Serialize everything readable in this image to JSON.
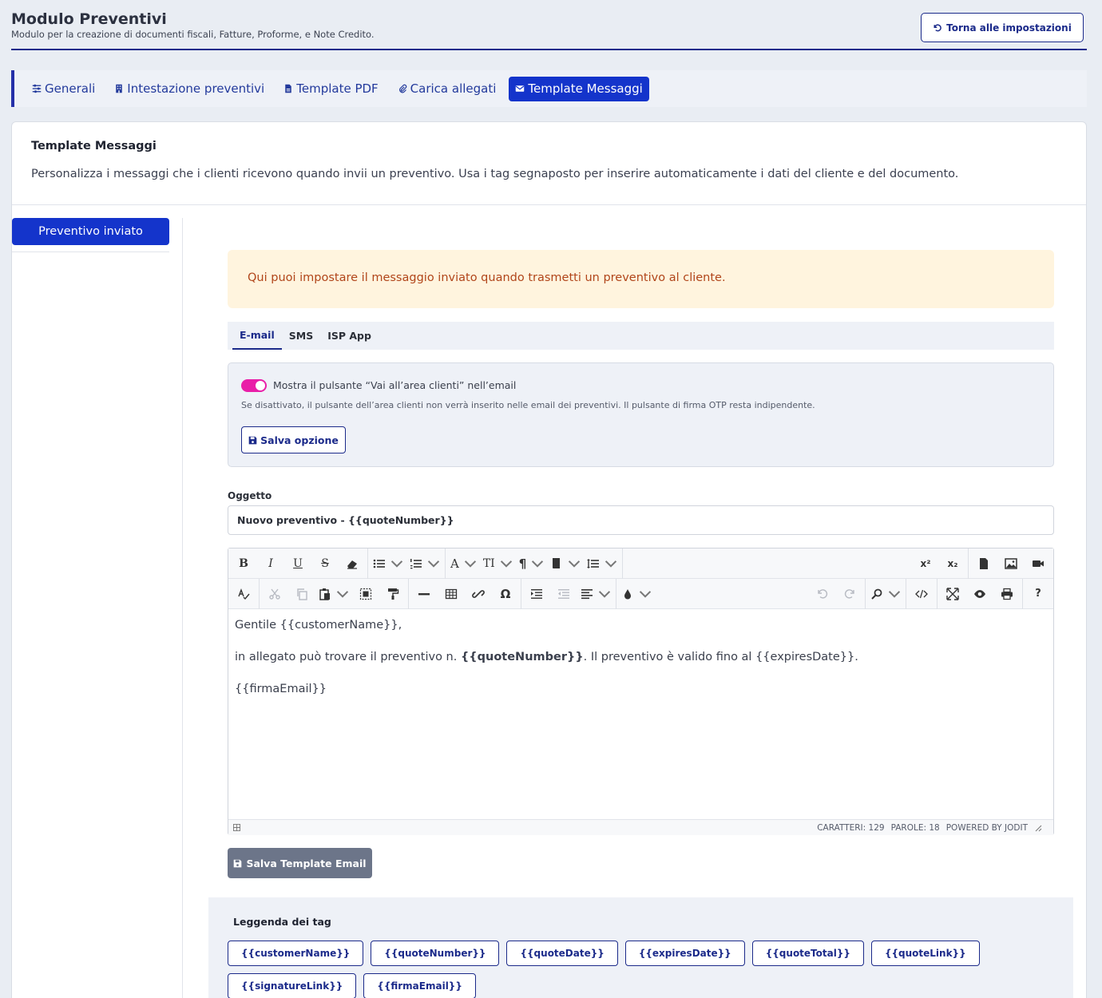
{
  "header": {
    "title": "Modulo Preventivi",
    "subtitle": "Modulo per la creazione di documenti fiscali, Fatture, Proforme, e Note Credito.",
    "back_button": "Torna alle impostazioni"
  },
  "nav_tabs": [
    {
      "label": "Generali",
      "icon": "sliders-icon"
    },
    {
      "label": "Intestazione preventivi",
      "icon": "building-icon"
    },
    {
      "label": "Template PDF",
      "icon": "pdf-file-icon"
    },
    {
      "label": "Carica allegati",
      "icon": "paperclip-icon"
    },
    {
      "label": "Template Messaggi",
      "icon": "envelope-icon",
      "active": true
    }
  ],
  "card": {
    "title": "Template Messaggi",
    "description": "Personalizza i messaggi che i clienti ricevono quando invii un preventivo. Usa i tag segnaposto per inserire automaticamente i dati del cliente e del documento."
  },
  "sidebar": {
    "items": [
      {
        "label": "Preventivo inviato",
        "active": true
      }
    ]
  },
  "alert": "Qui puoi impostare il messaggio inviato quando trasmetti un preventivo al cliente.",
  "channel_tabs": [
    {
      "label": "E-mail",
      "active": true
    },
    {
      "label": "SMS"
    },
    {
      "label": "ISP App"
    }
  ],
  "option": {
    "toggle_on": true,
    "label": "Mostra il pulsante “Vai all’area clienti” nell’email",
    "help": "Se disattivato, il pulsante dell’area clienti non verrà inserito nelle email dei preventivi. Il pulsante di firma OTP resta indipendente.",
    "save_label": "Salva opzione"
  },
  "subject": {
    "label": "Oggetto",
    "value": "Nuovo preventivo - {{quoteNumber}}"
  },
  "editor": {
    "line1": "Gentile {{customerName}},",
    "line2_before": "in allegato può trovare il preventivo n. ",
    "line2_bold": "{{quoteNumber}}",
    "line2_after": ". Il preventivo è valido fino al {{expiresDate}}.",
    "line3": "{{firmaEmail}}",
    "status_chars": "CARATTERI: 129",
    "status_words": "PAROLE: 18",
    "status_powered": "POWERED BY JODIT",
    "toolbar": {
      "bold": "B",
      "italic": "I",
      "underline": "U",
      "strike": "S",
      "font": "A",
      "fontsize": "TI",
      "paragraph": "¶",
      "superscript": "x²",
      "subscript": "x₂",
      "omega": "Ω",
      "help": "?"
    }
  },
  "save_template": "Salva Template Email",
  "legend": {
    "title": "Leggenda dei tag",
    "tags": [
      "{{customerName}}",
      "{{quoteNumber}}",
      "{{quoteDate}}",
      "{{expiresDate}}",
      "{{quoteTotal}}",
      "{{quoteLink}}",
      "{{signatureLink}}",
      "{{firmaEmail}}"
    ]
  },
  "colors": {
    "primary": "#1434cb",
    "navy": "#1b2a8a",
    "toggle": "#e91ea8",
    "alert_bg": "#fff4de",
    "alert_text": "#b1451a"
  }
}
